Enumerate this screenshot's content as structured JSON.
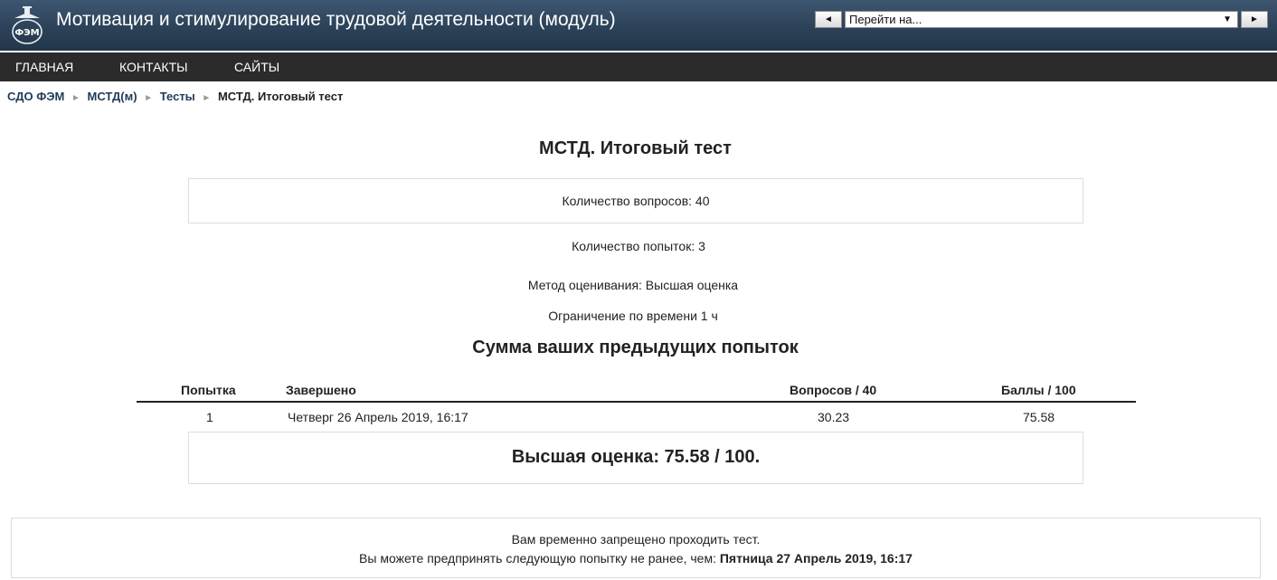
{
  "header": {
    "logo_text": "ФЭМ",
    "title": "Мотивация и стимулирование трудовой деятельности (модуль)",
    "jump_placeholder": "Перейти на...",
    "prev_icon": "triangle-left-icon",
    "next_icon": "triangle-right-icon"
  },
  "nav": {
    "items": [
      {
        "label": "ГЛАВНАЯ"
      },
      {
        "label": "КОНТАКТЫ"
      },
      {
        "label": "САЙТЫ"
      }
    ]
  },
  "breadcrumb": {
    "items": [
      "СДО ФЭМ",
      "МСТД(м)",
      "Тесты",
      "МСТД. Итоговый тест"
    ],
    "separator": "►"
  },
  "quiz": {
    "title": "МСТД. Итоговый тест",
    "questions_count": "Количество вопросов: 40",
    "attempts_count": "Количество попыток: 3",
    "grading_method": "Метод оценивания: Высшая оценка",
    "time_limit": "Ограничение по времени  1 ч"
  },
  "summary": {
    "title": "Сумма ваших предыдущих попыток",
    "columns": [
      "Попытка",
      "Завершено",
      "Вопросов / 40",
      "Баллы / 100"
    ],
    "rows": [
      [
        "1",
        "Четверг 26 Апрель 2019, 16:17",
        "30.23",
        "75.58"
      ]
    ],
    "highest_grade": "Высшая оценка: 75.58 / 100."
  },
  "notice": {
    "line1": "Вам временно запрещено проходить тест.",
    "line2_prefix": "Вы можете предпринять следующую попытку не ранее, чем: ",
    "line2_date": "Пятница 27 Апрель 2019, 16:17"
  }
}
